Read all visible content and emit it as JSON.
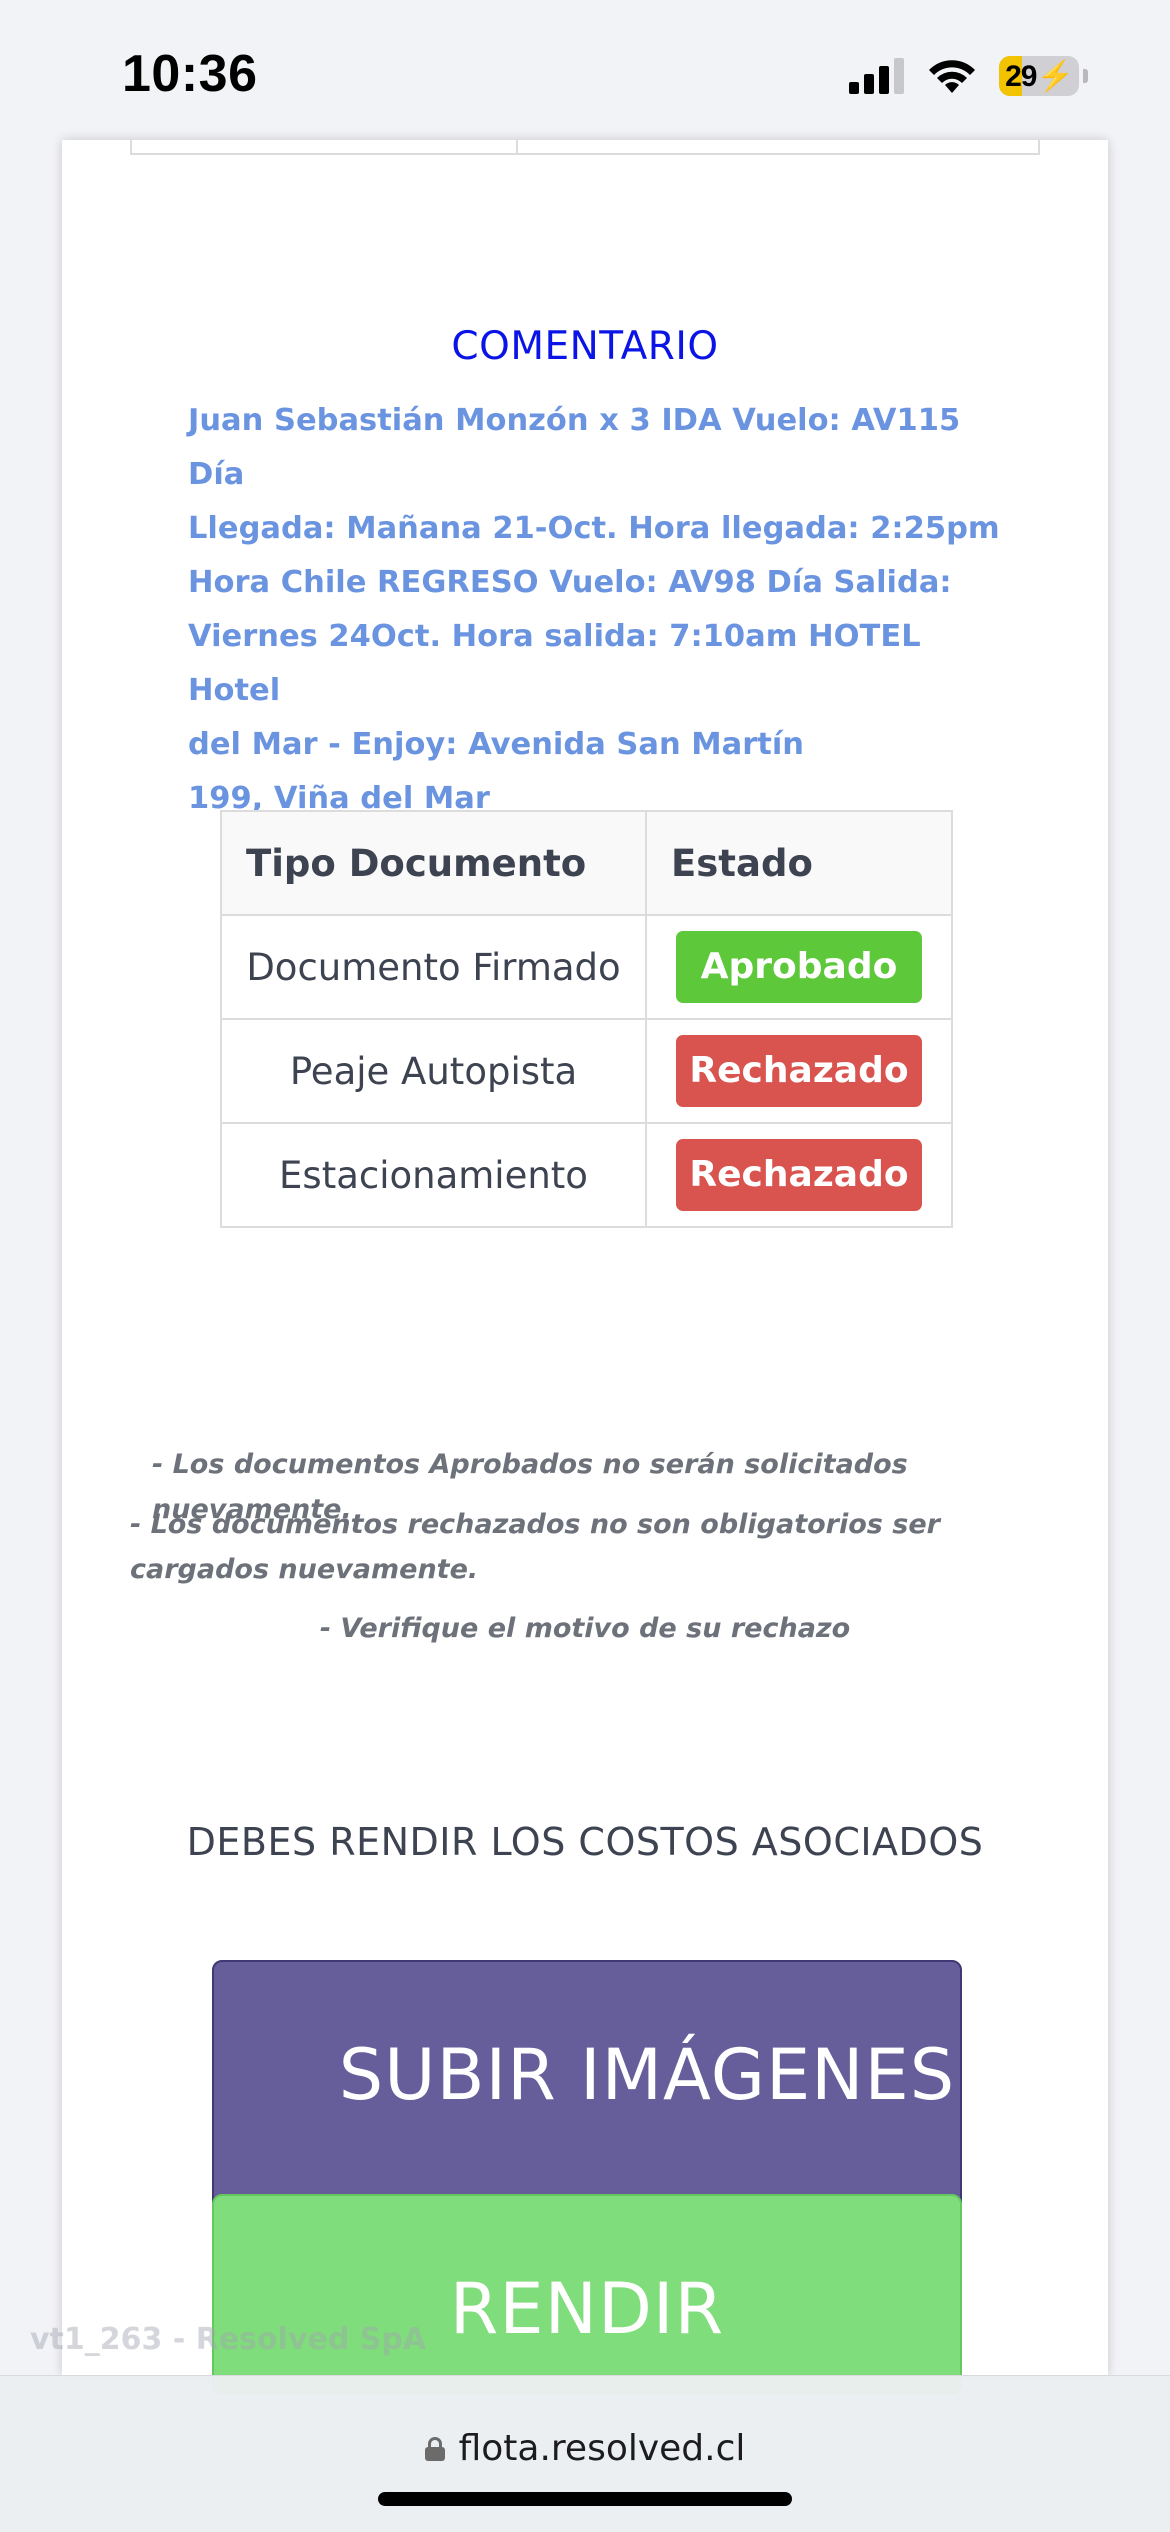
{
  "status_bar": {
    "time": "10:36",
    "battery_level": "29",
    "battery_fraction": 0.29,
    "icons": [
      "cellular-signal-icon",
      "wifi-icon",
      "battery-charging-icon"
    ]
  },
  "comment": {
    "title": "COMENTARIO",
    "lines": [
      "Juan Sebastián Monzón x 3 IDA Vuelo: AV115 Día",
      "Llegada: Mañana 21-Oct. Hora llegada: 2:25pm",
      "Hora Chile REGRESO Vuelo: AV98 Día Salida:",
      "Viernes 24Oct. Hora salida: 7:10am HOTEL Hotel",
      "del Mar - Enjoy: Avenida San Martín",
      "199, Viña del Mar"
    ]
  },
  "documents_table": {
    "headers": [
      "Tipo Documento",
      "Estado"
    ],
    "rows": [
      {
        "type": "Documento Firmado",
        "status": "Aprobado"
      },
      {
        "type": "Peaje Autopista",
        "status": "Rechazado"
      },
      {
        "type": "Estacionamiento",
        "status": "Rechazado"
      }
    ]
  },
  "notes": {
    "approved": "- Los documentos Aprobados no serán solicitados nuevamente.",
    "rejected": "- Los documentos rechazados no son obligatorios ser cargados nuevamente.",
    "verify": "- Verifique el motivo de su rechazo"
  },
  "costs": {
    "title": "DEBES RENDIR LOS COSTOS ASOCIADOS",
    "upload_label": "SUBIR IMÁGENES",
    "render_label": "RENDIR"
  },
  "watermark": "vt1_263 - Resolved SpA",
  "browser": {
    "url": "flota.resolved.cl"
  },
  "colors": {
    "approved": "#5cc83a",
    "rejected": "#d9534f",
    "upload_button": "#665e9b",
    "render_button": "#80dd7b",
    "comment_title": "#0a14e6",
    "comment_text": "#6b94e0"
  }
}
